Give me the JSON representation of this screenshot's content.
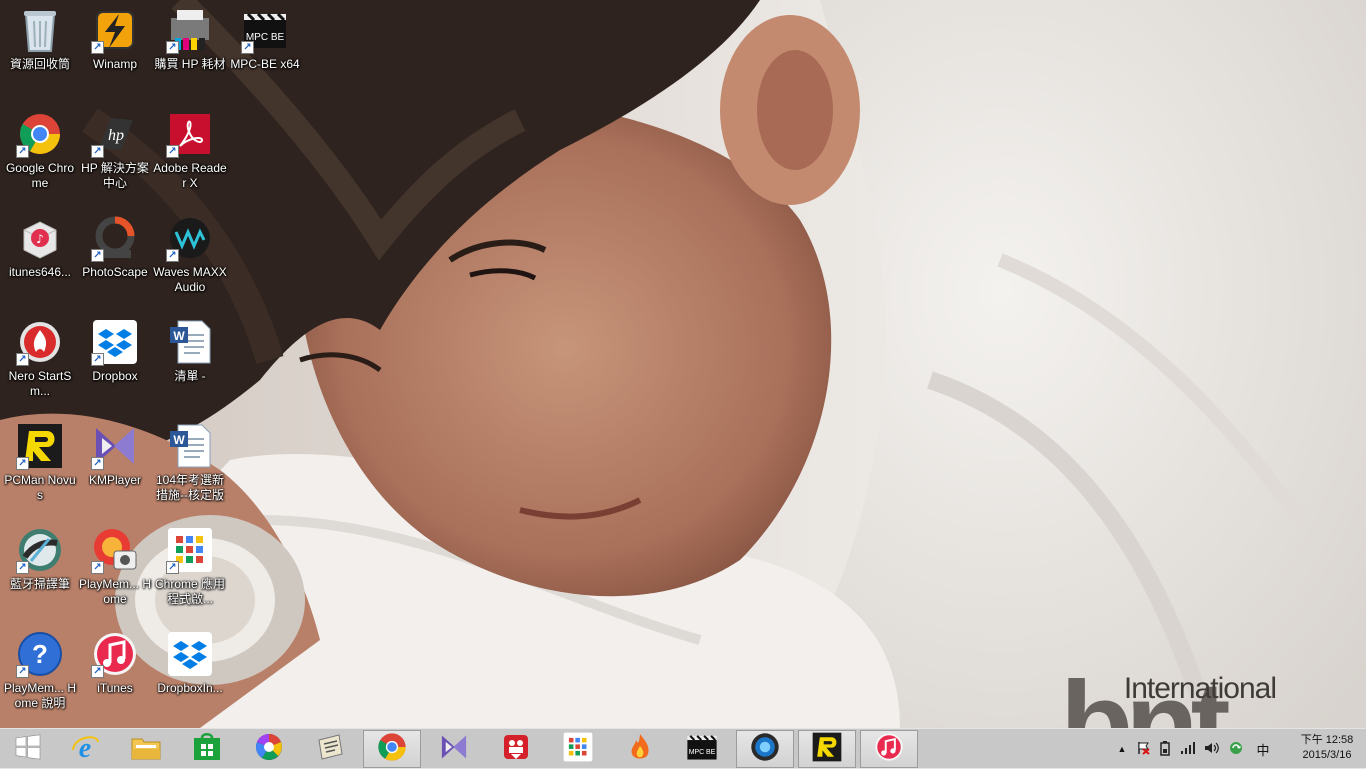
{
  "desktop": {
    "icons": [
      {
        "label": "資源回收筒",
        "icon": "recycle-bin-icon",
        "shortcut": false
      },
      {
        "label": "Winamp",
        "icon": "winamp-icon",
        "shortcut": true
      },
      {
        "label": "購買 HP 耗材",
        "icon": "hp-supplies-icon",
        "shortcut": true
      },
      {
        "label": "MPC-BE x64",
        "icon": "mpc-be-icon",
        "shortcut": true
      },
      {
        "label": "Google Chrome",
        "icon": "chrome-icon",
        "shortcut": true
      },
      {
        "label": "HP 解決方案中心",
        "icon": "hp-solution-center-icon",
        "shortcut": true
      },
      {
        "label": "Adobe Reader X",
        "icon": "adobe-reader-icon",
        "shortcut": true
      },
      {
        "label": "itunes646...",
        "icon": "itunes-installer-icon",
        "shortcut": false
      },
      {
        "label": "PhotoScape",
        "icon": "photoscape-icon",
        "shortcut": true
      },
      {
        "label": "Waves MAXXAudio",
        "icon": "waves-maxxaudio-icon",
        "shortcut": true
      },
      {
        "label": "Nero StartSm...",
        "icon": "nero-icon",
        "shortcut": true
      },
      {
        "label": "Dropbox",
        "icon": "dropbox-icon",
        "shortcut": true
      },
      {
        "label": "清單 -",
        "icon": "word-document-icon",
        "shortcut": false
      },
      {
        "label": "PCMan Novus",
        "icon": "pcman-icon",
        "shortcut": true
      },
      {
        "label": "KMPlayer",
        "icon": "kmplayer-icon",
        "shortcut": true
      },
      {
        "label": "104年考選新措施--核定版",
        "icon": "word-document-icon",
        "shortcut": false
      },
      {
        "label": "藍牙掃譯筆",
        "icon": "bluetooth-scanner-icon",
        "shortcut": true
      },
      {
        "label": "PlayMem... Home",
        "icon": "playmemories-icon",
        "shortcut": true
      },
      {
        "label": "Chrome 應用程式啟...",
        "icon": "chrome-apps-icon",
        "shortcut": true
      },
      {
        "label": "PlayMem... Home 說明",
        "icon": "help-icon",
        "shortcut": true
      },
      {
        "label": "iTunes",
        "icon": "itunes-icon",
        "shortcut": true
      },
      {
        "label": "DropboxIn...",
        "icon": "dropbox-installer-icon",
        "shortcut": false
      }
    ]
  },
  "wallpaper": {
    "watermark_text": "International",
    "watermark_logo": "bnt"
  },
  "taskbar": {
    "start_icon": "windows-start-icon",
    "pinned": [
      {
        "name": "internet-explorer-icon",
        "active": false
      },
      {
        "name": "file-explorer-icon",
        "active": false
      },
      {
        "name": "windows-store-icon",
        "active": false
      },
      {
        "name": "picasa-icon",
        "active": false
      },
      {
        "name": "scanner-tool-icon",
        "active": false
      },
      {
        "name": "chrome-icon",
        "active": true
      },
      {
        "name": "kmplayer-icon",
        "active": false
      },
      {
        "name": "video-downloader-icon",
        "active": false
      },
      {
        "name": "chrome-apps-icon",
        "active": false
      },
      {
        "name": "hotspot-shield-icon",
        "active": false
      },
      {
        "name": "mpc-be-icon",
        "active": false
      },
      {
        "name": "bluetooth-scanner-icon",
        "active": true
      },
      {
        "name": "pcman-icon",
        "active": true
      },
      {
        "name": "itunes-icon",
        "active": true
      }
    ],
    "tray": {
      "ime": "中",
      "clock_time": "下午 12:58",
      "clock_date": "2015/3/16"
    }
  },
  "colors": {
    "taskbar_bg": "#c8c8c8",
    "label_text": "#ffffff"
  }
}
